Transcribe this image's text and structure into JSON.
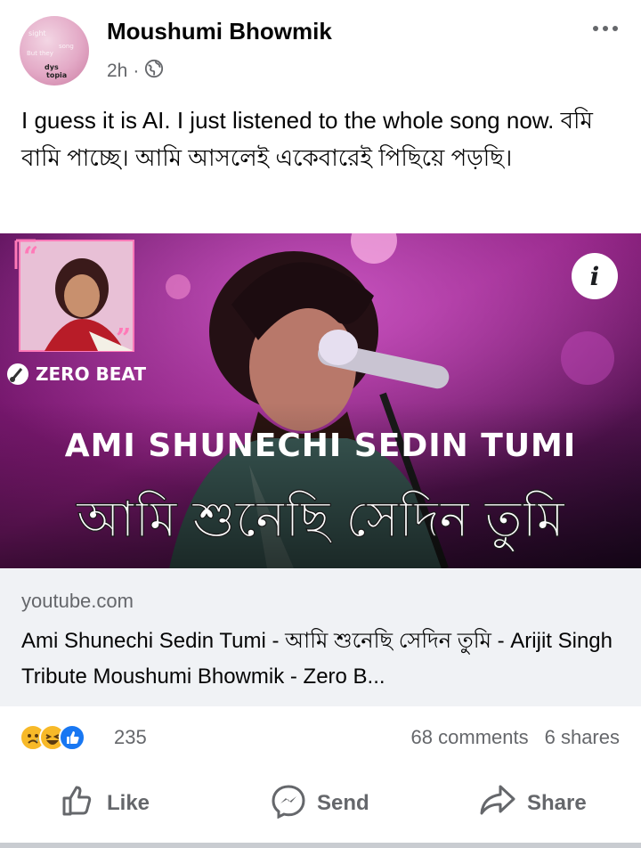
{
  "post": {
    "author": "Moushumi Bhowmik",
    "time": "2h",
    "time_separator": "·",
    "text": "I guess it is AI. I just listened to the whole song now. বমি বামি পাচ্ছে।  আমি আসলেই একেবারেই পিছিয়ে পড়ছি।"
  },
  "media": {
    "brand": "ZERO BEAT",
    "title_en": "AMI SHUNECHI SEDIN TUMI",
    "title_bn": "আমি শুনেছি সেদিন তুমি",
    "info_glyph": "i"
  },
  "link": {
    "domain": "youtube.com",
    "title": "Ami Shunechi Sedin Tumi - আমি শুনেছি সেদিন তুমি - Arijit Singh Tribute Moushumi Bhowmik - Zero B..."
  },
  "stats": {
    "reaction_count": "235",
    "comments": "68 comments",
    "shares": "6 shares"
  },
  "actions": {
    "like": "Like",
    "send": "Send",
    "share": "Share"
  },
  "icons": [
    "more-options-icon",
    "globe-icon",
    "info-icon",
    "sad-reaction-icon",
    "haha-reaction-icon",
    "like-reaction-icon",
    "like-icon",
    "messenger-icon",
    "share-icon"
  ],
  "colors": {
    "text": "#050505",
    "secondary": "#65676b",
    "link_bg": "#f0f2f5",
    "like_blue": "#1877f2",
    "reaction_yellow": "#f7b928"
  }
}
